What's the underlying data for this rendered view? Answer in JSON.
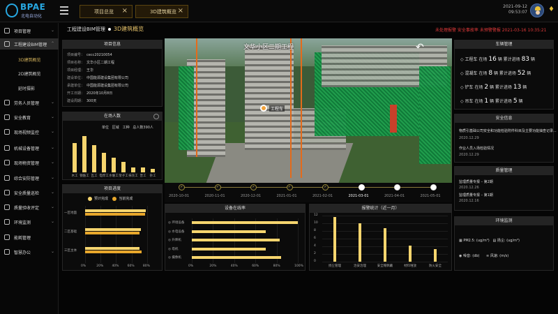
{
  "brand": {
    "name": "BPAE",
    "subtitle": "北电自动化"
  },
  "top_tabs": [
    {
      "label": "项目总览"
    },
    {
      "label": "3D建筑概览"
    }
  ],
  "datetime": {
    "date": "2021-09-12",
    "time": "09:53:07"
  },
  "sidebar": {
    "items": [
      {
        "label": "项目管理",
        "icon": "grid-icon"
      },
      {
        "label": "工程建设BIM管理",
        "icon": "network-icon"
      },
      {
        "label": "劳务人员管理",
        "icon": "worker-icon"
      },
      {
        "label": "安全教育",
        "icon": "shield-icon"
      },
      {
        "label": "现场视频监控",
        "icon": "camera-icon"
      },
      {
        "label": "机械设备管理",
        "icon": "machine-icon"
      },
      {
        "label": "现场物资管理",
        "icon": "box-icon"
      },
      {
        "label": "综合安防管理",
        "icon": "lock-icon"
      },
      {
        "label": "安全质量巡检",
        "icon": "check-icon"
      },
      {
        "label": "质量验收评定",
        "icon": "stamp-icon"
      },
      {
        "label": "环境监测",
        "icon": "leaf-icon"
      },
      {
        "label": "能耗管理",
        "icon": "bolt-icon"
      },
      {
        "label": "智慧办公",
        "icon": "office-icon"
      }
    ],
    "sub_items": [
      {
        "label": "3D建筑概览"
      },
      {
        "label": "2D建筑概览"
      },
      {
        "label": "延时摄影"
      }
    ]
  },
  "breadcrumb": {
    "parent": "工程建设BIM管理",
    "current": "3D建筑概览"
  },
  "alerts_text": "未处理报警 安全事故率 未预警警报 2021-03-16 10:35:21",
  "project_info": {
    "title": "项目信息",
    "rows": [
      {
        "k": "项目编号：",
        "v": "cecc20210054"
      },
      {
        "k": "项目名称：",
        "v": "文华小区二期工程"
      },
      {
        "k": "项目经理：",
        "v": "王华"
      },
      {
        "k": "建设单位：",
        "v": "中国能源建设集团有限公司"
      },
      {
        "k": "承建单位：",
        "v": "中国能源建设集团有限公司"
      },
      {
        "k": "开工日期：",
        "v": "2020年10月8日"
      },
      {
        "k": "建设周期：",
        "v": "300天"
      }
    ]
  },
  "attendance": {
    "title": "在场人数",
    "legend": [
      "单位",
      "区域",
      "工种",
      "总人数390人"
    ],
    "chart_data": {
      "type": "bar",
      "categories": [
        "木工",
        "钢筋工",
        "瓦工",
        "电焊工",
        "水暖工",
        "架子工",
        "抹灰工",
        "普工",
        "杂工"
      ],
      "values": [
        63,
        78,
        58,
        42,
        32,
        22,
        10,
        10,
        8
      ],
      "ylim": [
        0,
        90
      ]
    }
  },
  "progress": {
    "title": "项目进度",
    "legend": [
      "预计完成",
      "当前完成"
    ],
    "colors": {
      "planned": "#f6d56e",
      "current": "#e8a72b"
    },
    "chart_data": {
      "type": "bar",
      "orientation": "horizontal",
      "categories": [
        "一区地面",
        "二区基础",
        "三区主体"
      ],
      "series": [
        {
          "name": "预计完成",
          "values": [
            78,
            72,
            70
          ]
        },
        {
          "name": "当前完成",
          "values": [
            77,
            70,
            73
          ]
        }
      ],
      "xticks": [
        "0%",
        "20%",
        "40%",
        "60%",
        "80%"
      ],
      "xlim": [
        0,
        90
      ]
    }
  },
  "scene": {
    "title": "文华小区二期工程",
    "pin_label": "工程车"
  },
  "timeline": {
    "dates": [
      "2020-10-01",
      "2020-11-01",
      "2020-12-01",
      "2021-01-01",
      "2021-02-01",
      "2021-03-01",
      "2021-04-01",
      "2021-05-01"
    ],
    "current_index": 5
  },
  "equipment": {
    "title": "设备在线率",
    "chart_data": {
      "type": "bar",
      "orientation": "horizontal",
      "categories": [
        "环境设备",
        "水电设备",
        "升降机",
        "塔机",
        "摄像机"
      ],
      "values": [
        100,
        70,
        83,
        70,
        84
      ],
      "xticks": [
        "0%",
        "20%",
        "40%",
        "60%",
        "80%",
        "100%"
      ],
      "xlim": [
        0,
        100
      ]
    }
  },
  "alarm_stats": {
    "title": "报警统计（近一月）",
    "chart_data": {
      "type": "bar",
      "categories": [
        "扬尘管理",
        "治安治理",
        "安全帽佩戴",
        "材料堆放",
        "防火安全"
      ],
      "values": [
        11.7,
        10,
        8.8,
        4.1,
        3.3
      ],
      "yticks": [
        "0",
        "2",
        "4",
        "6",
        "8",
        "10",
        "12"
      ],
      "ylim": [
        0,
        12
      ]
    }
  },
  "vehicles": {
    "title": "车辆管理",
    "rows": [
      {
        "type": "工程车",
        "in": "16",
        "total": "83"
      },
      {
        "type": "混凝车",
        "in": "8",
        "total": "52"
      },
      {
        "type": "铲车",
        "in": "2",
        "total": "13"
      },
      {
        "type": "吊车",
        "in": "1",
        "total": "5"
      }
    ],
    "in_label": "在场",
    "total_label": "累计进场",
    "unit": "辆"
  },
  "safety": {
    "title": "安全信息",
    "items": [
      {
        "text": "物质引基础公司安全和功能检验附件科目及主要功能抽查记录...",
        "date": "2020.12.29"
      },
      {
        "text": "作业人员入场检验情况",
        "date": "2020.12.29"
      }
    ]
  },
  "quality": {
    "title": "质量管理",
    "items": [
      {
        "text": "监理质量专报 – 第2期",
        "date": "2020.12.26"
      },
      {
        "text": "监理质量专报 – 第1期",
        "date": "2020.12.16"
      }
    ]
  },
  "environment": {
    "title": "环境监测",
    "rows": [
      {
        "label": "PM2.5:",
        "unit": "(ug/m³)",
        "label2": "扬尘:",
        "unit2": "(ug/m³)"
      },
      {
        "label": "噪音:",
        "unit": "(db)",
        "label2": "风速:",
        "unit2": "(m/s)"
      }
    ]
  }
}
